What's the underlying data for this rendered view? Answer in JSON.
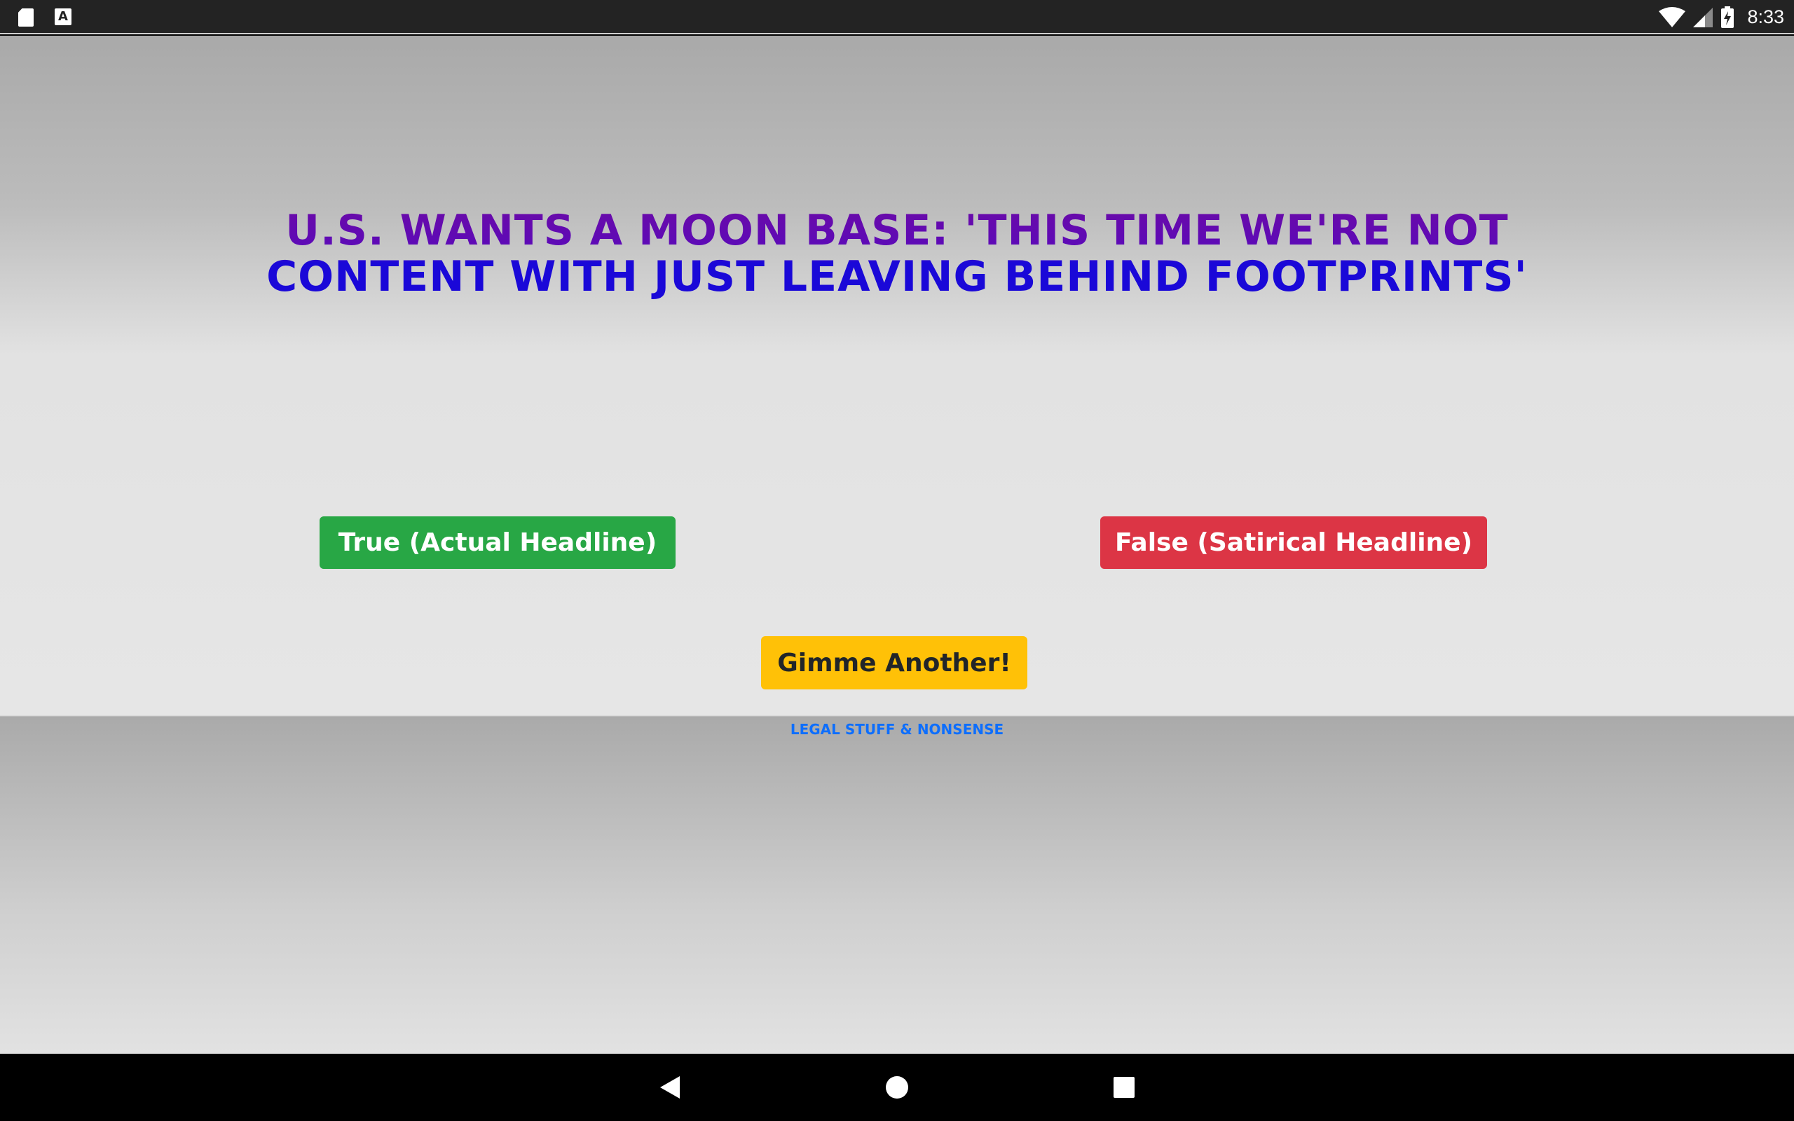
{
  "status_bar": {
    "time": "8:33",
    "left_icons": [
      "sd-card-icon",
      "a-notification-icon"
    ],
    "right_icons": [
      "wifi-icon",
      "signal-icon",
      "battery-charging-icon"
    ]
  },
  "main": {
    "headline": "U.S. Wants A Moon Base: 'This Time We're Not Content With Just Leaving Behind Footprints'",
    "buttons": {
      "true_label": "True (Actual Headline)",
      "false_label": "False (Satirical Headline)",
      "another_label": "Gimme Another!"
    },
    "legal_link": "Legal Stuff & Nonsense"
  },
  "nav_bar": {
    "icons": [
      "back-icon",
      "home-icon",
      "recents-icon"
    ]
  },
  "colors": {
    "true_button": "#28a745",
    "false_button": "#dc3545",
    "another_button": "#ffc107",
    "headline_top": "#6a0aa8",
    "headline_bottom": "#1a08d8",
    "link": "#0d6efd"
  }
}
